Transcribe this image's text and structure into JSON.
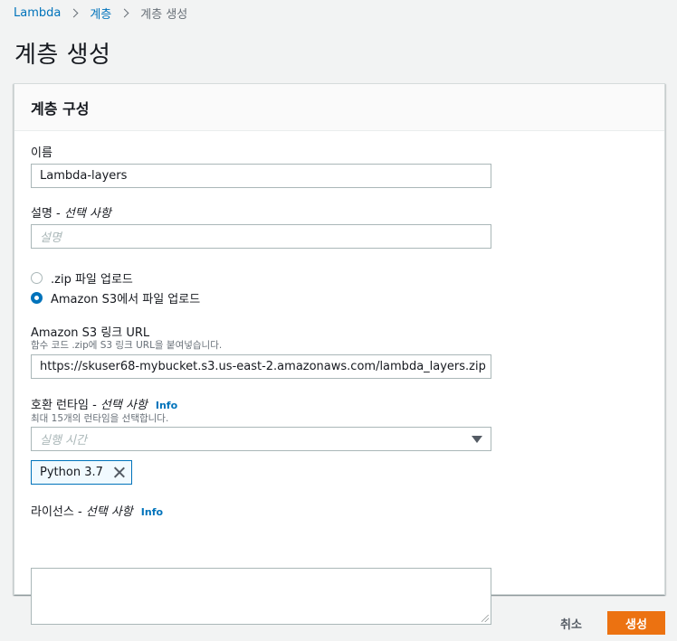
{
  "breadcrumb": {
    "items": [
      "Lambda",
      "계층"
    ],
    "current": "계층 생성"
  },
  "page": {
    "title": "계층 생성"
  },
  "panel": {
    "header": "계층 구성",
    "name": {
      "label": "이름",
      "value": "Lambda-layers"
    },
    "description": {
      "label": "설명 - ",
      "optional": "선택 사항",
      "placeholder": "설명"
    },
    "upload": {
      "options": [
        {
          "label": ".zip 파일 업로드",
          "checked": false
        },
        {
          "label": "Amazon S3에서 파일 업로드",
          "checked": true
        }
      ]
    },
    "s3_url": {
      "label": "Amazon S3 링크 URL",
      "hint": "함수 코드 .zip에 S3 링크 URL을 붙여넣습니다.",
      "value": "https://skuser68-mybucket.s3.us-east-2.amazonaws.com/lambda_layers.zip"
    },
    "runtimes": {
      "label": "호환 런타임 - ",
      "optional": "선택 사항",
      "info": "Info",
      "hint": "최대 15개의 런타임을 선택합니다.",
      "placeholder": "실행 시간",
      "tokens": [
        "Python 3.7"
      ]
    },
    "license": {
      "label": "라이선스 - ",
      "optional": "선택 사항",
      "info": "Info"
    }
  },
  "actions": {
    "cancel": "취소",
    "create": "생성"
  },
  "colors": {
    "accent": "#0073bb",
    "primary_button": "#ec7211",
    "background": "#f2f3f3"
  }
}
